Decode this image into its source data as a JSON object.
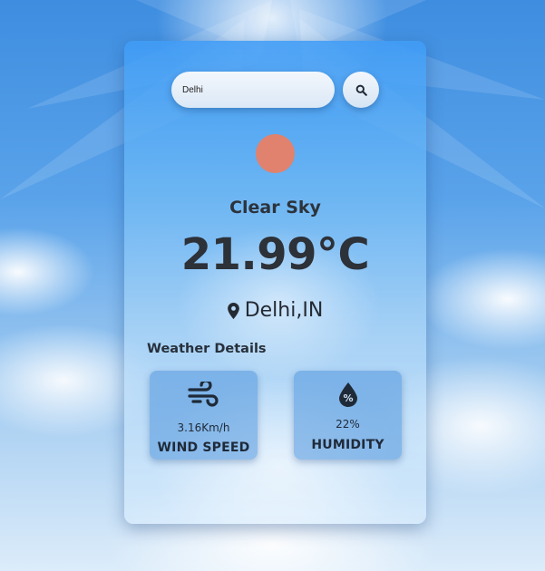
{
  "search": {
    "value": "Delhi"
  },
  "weather": {
    "condition": "Clear Sky",
    "temperature": "21.99°C",
    "location": "Delhi,IN"
  },
  "details": {
    "title": "Weather Details",
    "wind": {
      "value": "3.16Km/h",
      "label": "WIND SPEED"
    },
    "humidity": {
      "value": "22%",
      "label": "HUMIDITY"
    }
  },
  "colors": {
    "sun_icon": "#e0826e",
    "text_dark": "#2d3138"
  },
  "icons": {
    "search": "search-icon",
    "weather": "sun-icon",
    "location": "map-pin-icon",
    "wind": "wind-icon",
    "humidity": "humidity-drop-icon"
  }
}
